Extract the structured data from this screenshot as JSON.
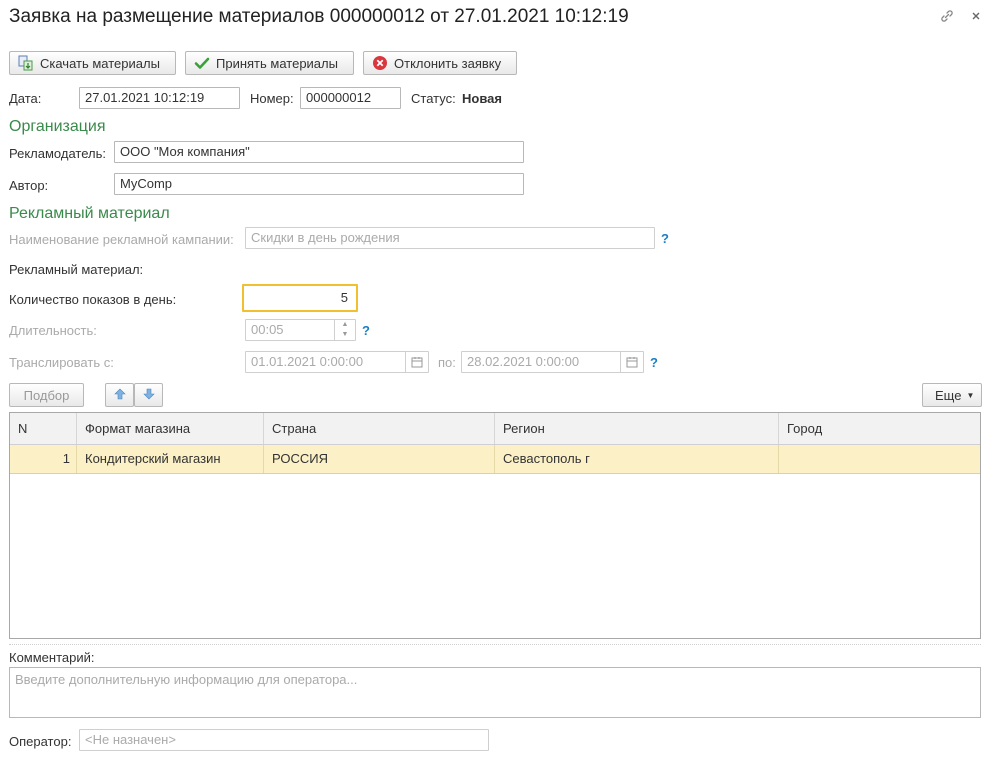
{
  "window": {
    "title": "Заявка на размещение материалов 000000012 от 27.01.2021 10:12:19"
  },
  "toolbar": {
    "download_label": "Скачать материалы",
    "accept_label": "Принять материалы",
    "reject_label": "Отклонить заявку"
  },
  "header": {
    "date_label": "Дата:",
    "date_value": "27.01.2021 10:12:19",
    "number_label": "Номер:",
    "number_value": "000000012",
    "status_label": "Статус:",
    "status_value": "Новая"
  },
  "organization": {
    "section_title": "Организация",
    "advertiser_label": "Рекламодатель:",
    "advertiser_value": "ООО \"Моя компания\"",
    "author_label": "Автор:",
    "author_value": "MyComp"
  },
  "material": {
    "section_title": "Рекламный материал",
    "campaign_label": "Наименование рекламной кампании:",
    "campaign_value": "Скидки в день рождения",
    "material_label": "Рекламный материал:",
    "shows_label": "Количество показов в день:",
    "shows_value": "5",
    "duration_label": "Длительность:",
    "duration_value": "00:05",
    "broadcast_from_label": "Транслировать с:",
    "broadcast_from_value": "01.01.2021  0:00:00",
    "broadcast_to_label": "по:",
    "broadcast_to_value": "28.02.2021  0:00:00",
    "help_mark": "?"
  },
  "table_toolbar": {
    "pick_label": "Подбор",
    "more_label": "Еще"
  },
  "table": {
    "columns": [
      "N",
      "Формат магазина",
      "Страна",
      "Регион",
      "Город"
    ],
    "rows": [
      [
        "1",
        "Кондитерский магазин",
        "РОССИЯ",
        "Севастополь г",
        ""
      ]
    ]
  },
  "comment": {
    "label": "Комментарий:",
    "placeholder": "Введите дополнительную информацию для оператора..."
  },
  "operator": {
    "label": "Оператор:",
    "placeholder": "<Не назначен>"
  },
  "colors": {
    "section_green": "#3a8a4c",
    "selected_row": "#fbf0c6",
    "focus_border": "#f0c030",
    "help_blue": "#1b7fc4"
  }
}
